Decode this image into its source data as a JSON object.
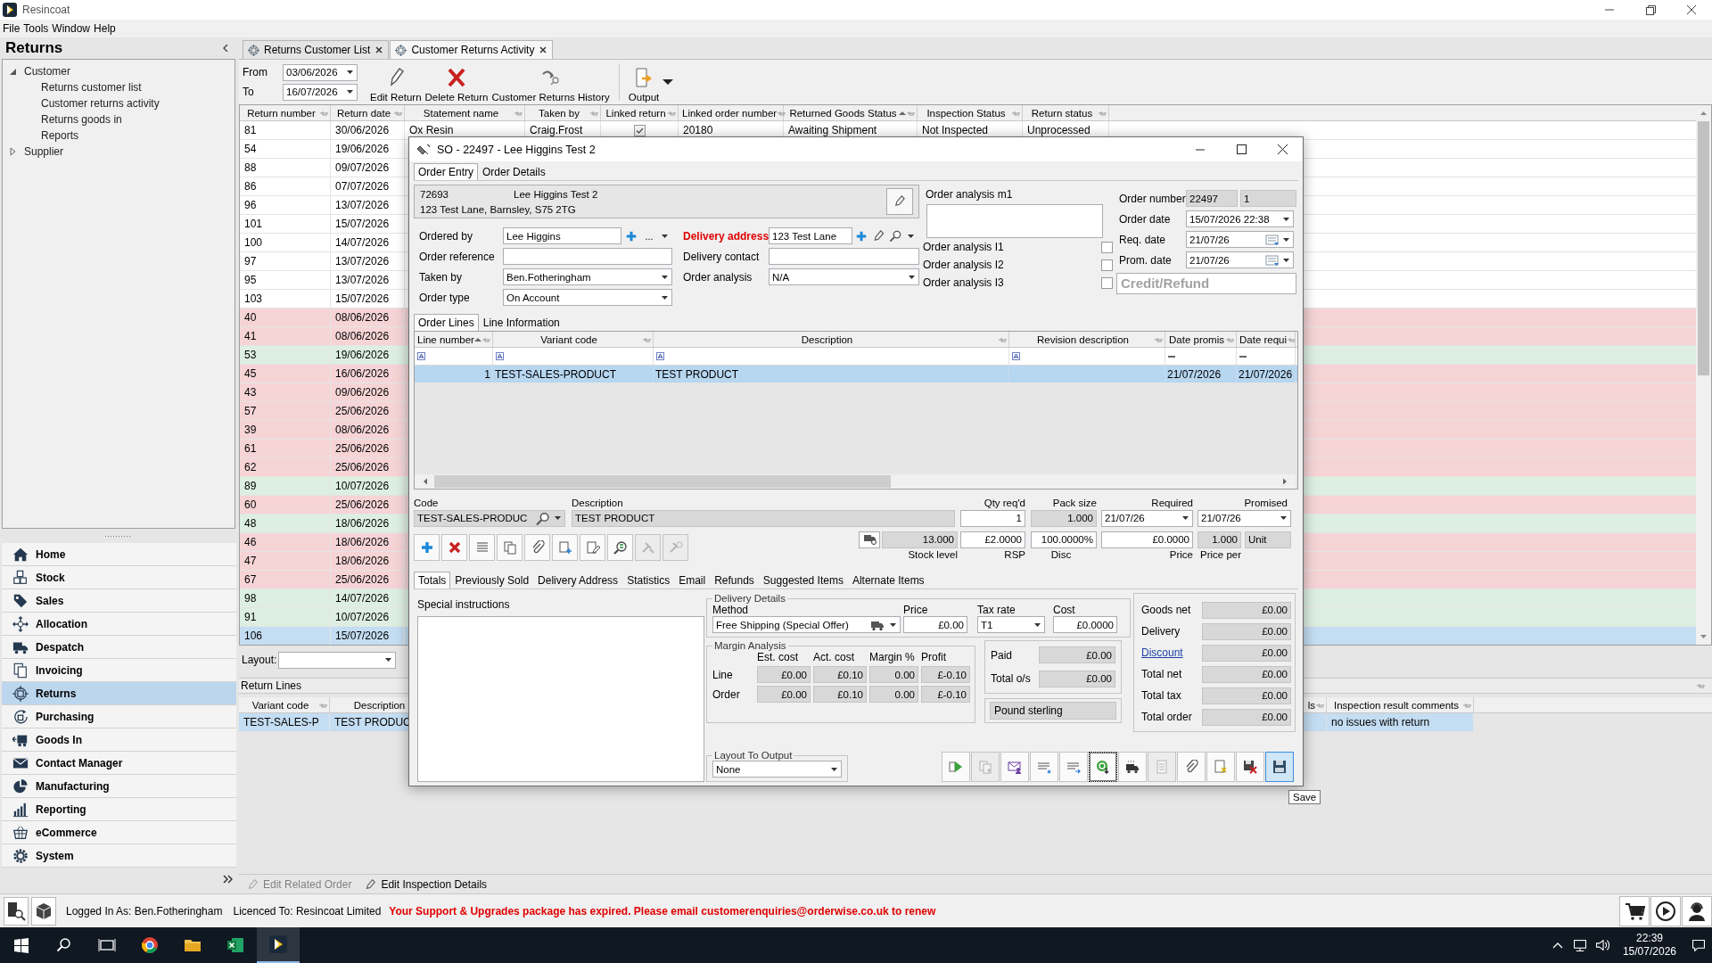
{
  "app": {
    "title": "Resincoat"
  },
  "menu": [
    "File",
    "Tools",
    "Window",
    "Help"
  ],
  "sidebar": {
    "title": "Returns",
    "tree": [
      {
        "label": "Customer",
        "expanded": true,
        "children": [
          {
            "label": "Returns customer list"
          },
          {
            "label": "Customer returns activity"
          },
          {
            "label": "Returns goods in"
          },
          {
            "label": "Reports"
          }
        ]
      },
      {
        "label": "Supplier",
        "expanded": false
      }
    ],
    "nav": [
      {
        "label": "Home",
        "selected": false
      },
      {
        "label": "Stock",
        "selected": false
      },
      {
        "label": "Sales",
        "selected": false
      },
      {
        "label": "Allocation",
        "selected": false
      },
      {
        "label": "Despatch",
        "selected": false
      },
      {
        "label": "Invoicing",
        "selected": false
      },
      {
        "label": "Returns",
        "selected": true
      },
      {
        "label": "Purchasing",
        "selected": false
      },
      {
        "label": "Goods In",
        "selected": false
      },
      {
        "label": "Contact Manager",
        "selected": false
      },
      {
        "label": "Manufacturing",
        "selected": false
      },
      {
        "label": "Reporting",
        "selected": false
      },
      {
        "label": "eCommerce",
        "selected": false
      },
      {
        "label": "System",
        "selected": false
      }
    ]
  },
  "doc_tabs": [
    {
      "label": "Returns Customer List",
      "selected": false
    },
    {
      "label": "Customer Returns Activity",
      "selected": true
    }
  ],
  "filters": [
    {
      "label": "From",
      "value": "03/06/2026"
    },
    {
      "label": "To",
      "value": "16/07/2026"
    }
  ],
  "toolbar": [
    {
      "label": "Edit Return"
    },
    {
      "label": "Delete Return"
    },
    {
      "label": "Customer Returns History"
    },
    {
      "label": "Output"
    }
  ],
  "returns_table": {
    "columns": [
      {
        "label": "Return number",
        "sorted": false
      },
      {
        "label": "Return date",
        "sorted": false
      },
      {
        "label": "Statement name",
        "sorted": false
      },
      {
        "label": "Taken by",
        "sorted": false
      },
      {
        "label": "Linked return",
        "sorted": false
      },
      {
        "label": "Linked order number",
        "sorted": false
      },
      {
        "label": "Returned Goods Status",
        "sorted": true
      },
      {
        "label": "Inspection Status",
        "sorted": false
      },
      {
        "label": "Return status",
        "sorted": false
      }
    ],
    "rows": [
      {
        "cells": [
          "81",
          "30/06/2026",
          "Ox Resin",
          "Craig.Frost",
          {
            "kind": "checkbox",
            "checked": true
          },
          "20180",
          "Awaiting Shipment",
          "Not Inspected",
          "Unprocessed"
        ],
        "color": "#ffffff",
        "selected": false
      },
      {
        "cells": [
          "54",
          "19/06/2026"
        ],
        "color": "#ffffff",
        "selected": false
      },
      {
        "cells": [
          "88",
          "09/07/2026"
        ],
        "color": "#ffffff",
        "selected": false
      },
      {
        "cells": [
          "86",
          "07/07/2026"
        ],
        "color": "#ffffff",
        "selected": false
      },
      {
        "cells": [
          "96",
          "13/07/2026"
        ],
        "color": "#ffffff",
        "selected": false
      },
      {
        "cells": [
          "101",
          "15/07/2026"
        ],
        "color": "#ffffff",
        "selected": false
      },
      {
        "cells": [
          "100",
          "14/07/2026"
        ],
        "color": "#ffffff",
        "selected": false
      },
      {
        "cells": [
          "97",
          "13/07/2026"
        ],
        "color": "#ffffff",
        "selected": false
      },
      {
        "cells": [
          "95",
          "13/07/2026"
        ],
        "color": "#ffffff",
        "selected": false
      },
      {
        "cells": [
          "103",
          "15/07/2026"
        ],
        "color": "#ffffff",
        "selected": false
      },
      {
        "cells": [
          "40",
          "08/06/2026"
        ],
        "color": "#f6d4d6",
        "selected": false
      },
      {
        "cells": [
          "41",
          "08/06/2026"
        ],
        "color": "#f6d4d6",
        "selected": false
      },
      {
        "cells": [
          "53",
          "19/06/2026"
        ],
        "color": "#dcefe1",
        "selected": false
      },
      {
        "cells": [
          "45",
          "16/06/2026"
        ],
        "color": "#f6d4d6",
        "selected": false
      },
      {
        "cells": [
          "43",
          "09/06/2026"
        ],
        "color": "#f6d4d6",
        "selected": false
      },
      {
        "cells": [
          "57",
          "25/06/2026"
        ],
        "color": "#f6d4d6",
        "selected": false
      },
      {
        "cells": [
          "39",
          "08/06/2026"
        ],
        "color": "#f6d4d6",
        "selected": false
      },
      {
        "cells": [
          "61",
          "25/06/2026"
        ],
        "color": "#f6d4d6",
        "selected": false
      },
      {
        "cells": [
          "62",
          "25/06/2026"
        ],
        "color": "#f6d4d6",
        "selected": false
      },
      {
        "cells": [
          "89",
          "10/07/2026"
        ],
        "color": "#dcefe1",
        "selected": false
      },
      {
        "cells": [
          "60",
          "25/06/2026"
        ],
        "color": "#f6d4d6",
        "selected": false
      },
      {
        "cells": [
          "48",
          "18/06/2026"
        ],
        "color": "#dcefe1",
        "selected": false
      },
      {
        "cells": [
          "46",
          "18/06/2026"
        ],
        "color": "#f6d4d6",
        "selected": false
      },
      {
        "cells": [
          "47",
          "18/06/2026"
        ],
        "color": "#f6d4d6",
        "selected": false
      },
      {
        "cells": [
          "67",
          "25/06/2026"
        ],
        "color": "#f6d4d6",
        "selected": false
      },
      {
        "cells": [
          "98",
          "14/07/2026"
        ],
        "color": "#dcefe1",
        "selected": false
      },
      {
        "cells": [
          "91",
          "10/07/2026"
        ],
        "color": "#dcefe1",
        "selected": false
      },
      {
        "cells": [
          "106",
          "15/07/2026"
        ],
        "selected": true
      }
    ]
  },
  "layout_label": "Layout:",
  "return_lines": {
    "title": "Return Lines",
    "columns": [
      "Variant code",
      "Description",
      "ls",
      "Inspection result comments"
    ],
    "rows": [
      {
        "cells": [
          "TEST-SALES-P",
          "TEST PRODUC"
        ],
        "comments": "no issues with return",
        "selected": true
      }
    ]
  },
  "bottom_actions": [
    {
      "label": "Edit Related Order",
      "disabled": true
    },
    {
      "label": "Edit Inspection Details",
      "disabled": false
    }
  ],
  "order_dialog": {
    "title": "SO - 22497 - Lee Higgins Test 2",
    "tabs": [
      {
        "label": "Order Entry",
        "selected": true
      },
      {
        "label": "Order Details",
        "selected": false
      }
    ],
    "customer": {
      "account": "72693",
      "name": "Lee Higgins Test 2",
      "address": "123 Test Lane, Barnsley, S75 2TG"
    },
    "fields_left": [
      {
        "label": "Ordered by",
        "value": "Lee Higgins",
        "kind": "lookup",
        "button_text": "...",
        "required": false
      },
      {
        "label": "Order reference",
        "kind": "text",
        "required": false
      },
      {
        "label": "Taken by",
        "value": "Ben.Fotheringham",
        "kind": "dropdown",
        "required": false
      },
      {
        "label": "Order type",
        "value": "On Account",
        "kind": "dropdown",
        "required": false
      }
    ],
    "fields_mid": [
      {
        "label": "Delivery address",
        "value": "123 Test Lane",
        "kind": "address",
        "required": true
      },
      {
        "label": "Delivery contact",
        "kind": "text",
        "required": false
      },
      {
        "label": "Order analysis",
        "value": "N/A",
        "kind": "dropdown",
        "required": false
      }
    ],
    "analysis": {
      "memo_label": "Order analysis m1",
      "flags": [
        {
          "label": "Order analysis I1",
          "checked": false
        },
        {
          "label": "Order analysis I2",
          "checked": false
        },
        {
          "label": "Order analysis I3",
          "checked": false
        }
      ]
    },
    "order_info": {
      "number_label": "Order number",
      "number": "22497",
      "revision": "1",
      "dates": [
        {
          "label": "Order date",
          "value": "15/07/2026 22:38",
          "kind": "datetime"
        },
        {
          "label": "Req. date",
          "value": "21/07/26",
          "kind": "date"
        },
        {
          "label": "Prom. date",
          "value": "21/07/26",
          "kind": "date"
        }
      ],
      "order_kind": "Credit/Refund"
    },
    "line_tabs": [
      {
        "label": "Order Lines",
        "selected": true
      },
      {
        "label": "Line Information",
        "selected": false
      }
    ],
    "lines_grid": {
      "columns": [
        {
          "label": "Line number",
          "sorted": true
        },
        {
          "label": "Variant code",
          "sorted": false
        },
        {
          "label": "Description",
          "sorted": false
        },
        {
          "label": "Revision description",
          "sorted": false
        },
        {
          "label": "Date promis",
          "sorted": false
        },
        {
          "label": "Date requi",
          "sorted": false
        }
      ],
      "rows": [
        {
          "line_number": "1",
          "variant_code": "TEST-SALES-PRODUCT",
          "description": "TEST PRODUCT",
          "date_promised": "21/07/2026",
          "date_required": "21/07/2026",
          "selected": true
        }
      ]
    },
    "line_editor": {
      "code_label": "Code",
      "code": "TEST-SALES-PRODUC",
      "description_label": "Description",
      "description": "TEST PRODUCT",
      "qty_label": "Qty req'd",
      "qty": "1",
      "pack_label": "Pack size",
      "pack": "1.000",
      "required_label": "Required",
      "required": "21/07/26",
      "promised_label": "Promised",
      "promised": "21/07/26",
      "stock": "13.000",
      "stock_label": "Stock level",
      "rsp": "£2.0000",
      "rsp_label": "RSP",
      "disc": "100.0000%",
      "disc_label": "Disc",
      "price": "£0.0000",
      "price_label": "Price",
      "price_per": "1.000",
      "price_per_label": "Price per",
      "unit": "Unit"
    },
    "line_tools": [
      {
        "disabled": false
      },
      {
        "disabled": false
      },
      {
        "disabled": false
      },
      {
        "disabled": false
      },
      {
        "disabled": false
      },
      {
        "disabled": false
      },
      {
        "disabled": false
      },
      {
        "disabled": false
      },
      {
        "disabled": true
      },
      {
        "disabled": true
      }
    ],
    "bottom_tabs": [
      {
        "label": "Totals",
        "selected": true
      },
      {
        "label": "Previously Sold",
        "selected": false
      },
      {
        "label": "Delivery Address",
        "selected": false
      },
      {
        "label": "Statistics",
        "selected": false
      },
      {
        "label": "Email",
        "selected": false
      },
      {
        "label": "Refunds",
        "selected": false
      },
      {
        "label": "Suggested Items",
        "selected": false
      },
      {
        "label": "Alternate Items",
        "selected": false
      }
    ],
    "special_instructions_label": "Special instructions",
    "delivery": {
      "title": "Delivery Details",
      "headers": [
        "Method",
        "Price",
        "Tax rate",
        "Cost"
      ],
      "method": "Free Shipping (Special Offer)",
      "price": "£0.00",
      "tax_rate": "T1",
      "cost": "£0.0000"
    },
    "margin": {
      "title": "Margin Analysis",
      "headers": [
        "Est. cost",
        "Act. cost",
        "Margin %",
        "Profit"
      ],
      "rows": [
        {
          "label": "Line",
          "values": [
            "£0.00",
            "£0.10",
            "0.00",
            "£-0.10"
          ]
        },
        {
          "label": "Order",
          "values": [
            "£0.00",
            "£0.10",
            "0.00",
            "£-0.10"
          ]
        }
      ]
    },
    "payment": [
      {
        "label": "Paid",
        "value": "£0.00"
      },
      {
        "label": "Total o/s",
        "value": "£0.00"
      }
    ],
    "currency": "Pound sterling",
    "layout_output": {
      "title": "Layout To Output",
      "value": "None"
    },
    "totals": [
      {
        "label": "Goods net",
        "value": "£0.00",
        "kind": "plain"
      },
      {
        "label": "Delivery",
        "value": "£0.00",
        "kind": "plain"
      },
      {
        "label": "Discount",
        "value": "£0.00",
        "kind": "link"
      },
      {
        "label": "Total net",
        "value": "£0.00",
        "kind": "plain"
      },
      {
        "label": "Total tax",
        "value": "£0.00",
        "kind": "plain"
      },
      {
        "label": "Total order",
        "value": "£0.00",
        "kind": "plain"
      }
    ],
    "actions": [
      {
        "disabled": false,
        "focused": false,
        "hovered": false
      },
      {
        "disabled": true,
        "focused": false,
        "hovered": false
      },
      {
        "disabled": false,
        "focused": false,
        "hovered": false
      },
      {
        "disabled": false,
        "focused": false,
        "hovered": false
      },
      {
        "disabled": false,
        "focused": false,
        "hovered": false
      },
      {
        "disabled": false,
        "focused": true,
        "hovered": false
      },
      {
        "disabled": false,
        "focused": false,
        "hovered": false
      },
      {
        "disabled": true,
        "focused": false,
        "hovered": false
      },
      {
        "disabled": false,
        "focused": false,
        "hovered": false
      },
      {
        "disabled": false,
        "focused": false,
        "hovered": false
      },
      {
        "disabled": false,
        "focused": false,
        "hovered": false
      },
      {
        "disabled": false,
        "focused": false,
        "hovered": true
      }
    ]
  },
  "tooltip": {
    "text": "Save"
  },
  "status": {
    "user": "Logged In As: Ben.Fotheringham",
    "licence": "Licenced To: Resincoat Limited",
    "alert": "Your Support & Upgrades package has expired. Please email customerenquiries@orderwise.co.uk to renew"
  },
  "taskbar": {
    "time": "22:39",
    "date": "15/07/2026"
  }
}
